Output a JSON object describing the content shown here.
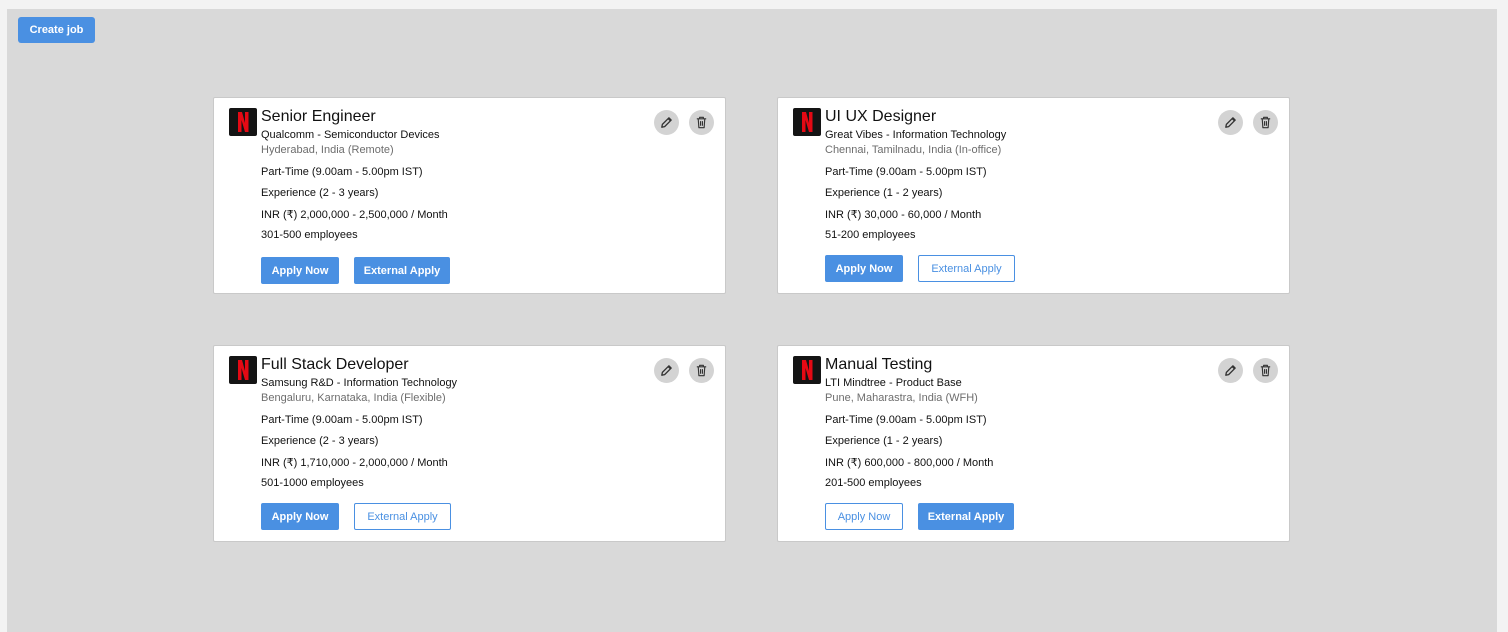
{
  "toolbar": {
    "create_label": "Create job"
  },
  "jobs": [
    {
      "title": "Senior Engineer",
      "company": "Qualcomm - Semiconductor Devices",
      "location": "Hyderabad, India (Remote)",
      "schedule": "Part-Time (9.00am - 5.00pm IST)",
      "experience": "Experience (2 - 3 years)",
      "salary": "INR (₹) 2,000,000 - 2,500,000 / Month",
      "employees": "301-500 employees",
      "apply_label": "Apply Now",
      "external_label": "External Apply",
      "apply_style": "filled",
      "external_style": "filled"
    },
    {
      "title": "UI UX Designer",
      "company": "Great Vibes - Information Technology",
      "location": "Chennai, Tamilnadu, India (In-office)",
      "schedule": "Part-Time (9.00am - 5.00pm IST)",
      "experience": "Experience (1 - 2 years)",
      "salary": "INR (₹) 30,000 - 60,000 / Month",
      "employees": "51-200 employees",
      "apply_label": "Apply Now",
      "external_label": "External Apply",
      "apply_style": "filled",
      "external_style": "outline"
    },
    {
      "title": "Full Stack Developer",
      "company": "Samsung R&D - Information Technology",
      "location": "Bengaluru, Karnataka, India (Flexible)",
      "schedule": "Part-Time (9.00am - 5.00pm IST)",
      "experience": "Experience (2 - 3 years)",
      "salary": "INR (₹) 1,710,000 - 2,000,000 / Month",
      "employees": "501-1000 employees",
      "apply_label": "Apply Now",
      "external_label": "External Apply",
      "apply_style": "filled",
      "external_style": "outline"
    },
    {
      "title": "Manual Testing",
      "company": "LTI Mindtree - Product Base",
      "location": "Pune, Maharastra, India (WFH)",
      "schedule": "Part-Time (9.00am - 5.00pm IST)",
      "experience": "Experience (1 - 2 years)",
      "salary": "INR (₹) 600,000 - 800,000 / Month",
      "employees": "201-500 employees",
      "apply_label": "Apply Now",
      "external_label": "External Apply",
      "apply_style": "outline",
      "external_style": "filled"
    }
  ],
  "icons": {
    "logo": "netflix-logo-icon",
    "edit": "pencil-icon",
    "delete": "trash-icon"
  },
  "colors": {
    "accent": "#4a90e2",
    "background": "#d9d9d9",
    "logo_red": "#e50914",
    "logo_bg": "#141414"
  }
}
